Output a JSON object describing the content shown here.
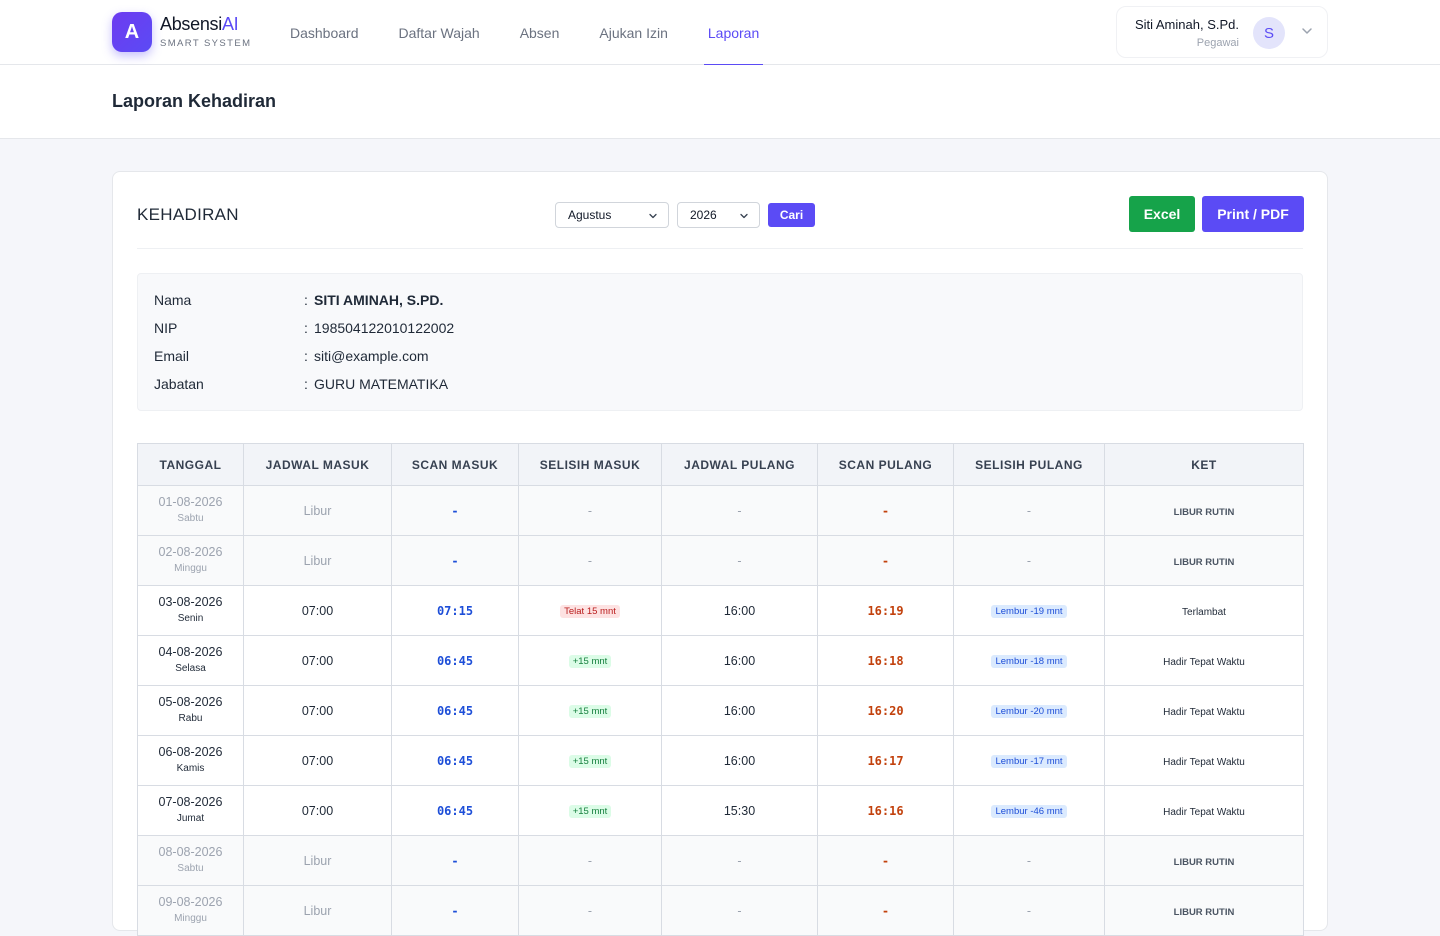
{
  "brand": {
    "logo_letter": "A",
    "name": "Absensi",
    "name_accent": "AI",
    "sub": "SMART SYSTEM"
  },
  "nav": [
    {
      "label": "Dashboard"
    },
    {
      "label": "Daftar Wajah"
    },
    {
      "label": "Absen"
    },
    {
      "label": "Ajukan Izin"
    },
    {
      "label": "Laporan",
      "active": true
    }
  ],
  "user": {
    "name": "Siti Aminah, S.Pd.",
    "role": "Pegawai",
    "initial": "S"
  },
  "page_title": "Laporan Kehadiran",
  "card": {
    "title": "KEHADIRAN",
    "month_select": "Agustus",
    "year_select": "2026",
    "search_label": "Cari",
    "excel_label": "Excel",
    "pdf_label": "Print / PDF"
  },
  "employee": {
    "fields": [
      {
        "label": "Nama",
        "value": "SITI AMINAH, S.PD.",
        "bold": true
      },
      {
        "label": "NIP",
        "value": "198504122010122002"
      },
      {
        "label": "Email",
        "value": "siti@example.com"
      },
      {
        "label": "Jabatan",
        "value": "GURU MATEMATIKA"
      }
    ]
  },
  "table": {
    "headers": [
      "TANGGAL",
      "JADWAL MASUK",
      "SCAN MASUK",
      "SELISIH MASUK",
      "JADWAL PULANG",
      "SCAN PULANG",
      "SELISIH PULANG",
      "KET"
    ],
    "rows": [
      {
        "date": "01-08-2026",
        "day": "Sabtu",
        "off": true,
        "jadwal_masuk": "Libur",
        "scan_masuk": "-",
        "selisih_masuk": "-",
        "jadwal_pulang": "-",
        "scan_pulang": "-",
        "selisih_pulang": "-",
        "ket": "LIBUR RUTIN"
      },
      {
        "date": "02-08-2026",
        "day": "Minggu",
        "off": true,
        "jadwal_masuk": "Libur",
        "scan_masuk": "-",
        "selisih_masuk": "-",
        "jadwal_pulang": "-",
        "scan_pulang": "-",
        "selisih_pulang": "-",
        "ket": "LIBUR RUTIN"
      },
      {
        "date": "03-08-2026",
        "day": "Senin",
        "off": false,
        "jadwal_masuk": "07:00",
        "scan_masuk": "07:15",
        "selisih_masuk": "Telat 15 mnt",
        "selisih_masuk_type": "late",
        "jadwal_pulang": "16:00",
        "scan_pulang": "16:19",
        "selisih_pulang": "Lembur -19 mnt",
        "ket": "Terlambat"
      },
      {
        "date": "04-08-2026",
        "day": "Selasa",
        "off": false,
        "jadwal_masuk": "07:00",
        "scan_masuk": "06:45",
        "selisih_masuk": "+15 mnt",
        "selisih_masuk_type": "ok",
        "jadwal_pulang": "16:00",
        "scan_pulang": "16:18",
        "selisih_pulang": "Lembur -18 mnt",
        "ket": "Hadir Tepat Waktu"
      },
      {
        "date": "05-08-2026",
        "day": "Rabu",
        "off": false,
        "jadwal_masuk": "07:00",
        "scan_masuk": "06:45",
        "selisih_masuk": "+15 mnt",
        "selisih_masuk_type": "ok",
        "jadwal_pulang": "16:00",
        "scan_pulang": "16:20",
        "selisih_pulang": "Lembur -20 mnt",
        "ket": "Hadir Tepat Waktu"
      },
      {
        "date": "06-08-2026",
        "day": "Kamis",
        "off": false,
        "jadwal_masuk": "07:00",
        "scan_masuk": "06:45",
        "selisih_masuk": "+15 mnt",
        "selisih_masuk_type": "ok",
        "jadwal_pulang": "16:00",
        "scan_pulang": "16:17",
        "selisih_pulang": "Lembur -17 mnt",
        "ket": "Hadir Tepat Waktu"
      },
      {
        "date": "07-08-2026",
        "day": "Jumat",
        "off": false,
        "jadwal_masuk": "07:00",
        "scan_masuk": "06:45",
        "selisih_masuk": "+15 mnt",
        "selisih_masuk_type": "ok",
        "jadwal_pulang": "15:30",
        "scan_pulang": "16:16",
        "selisih_pulang": "Lembur -46 mnt",
        "ket": "Hadir Tepat Waktu"
      },
      {
        "date": "08-08-2026",
        "day": "Sabtu",
        "off": true,
        "jadwal_masuk": "Libur",
        "scan_masuk": "-",
        "selisih_masuk": "-",
        "jadwal_pulang": "-",
        "scan_pulang": "-",
        "selisih_pulang": "-",
        "ket": "LIBUR RUTIN"
      },
      {
        "date": "09-08-2026",
        "day": "Minggu",
        "off": true,
        "jadwal_masuk": "Libur",
        "scan_masuk": "-",
        "selisih_masuk": "-",
        "jadwal_pulang": "-",
        "scan_pulang": "-",
        "selisih_pulang": "-",
        "ket": "LIBUR RUTIN"
      }
    ]
  },
  "colors": {
    "accent": "#5b4bf5",
    "success": "#16a34a",
    "scan_in": "#1d4ed8",
    "scan_out": "#c2410c"
  },
  "icons": {
    "user_menu": "chevron-down-icon",
    "select_caret": "chevron-down-icon"
  }
}
